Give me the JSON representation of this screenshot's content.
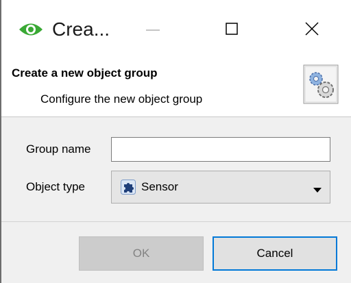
{
  "window": {
    "title": "Crea...",
    "app_icon": "eye-icon",
    "controls": {
      "minimize": "minimize-icon",
      "maximize": "maximize-icon",
      "close": "close-icon"
    }
  },
  "header": {
    "title": "Create a new object group",
    "subtitle": "Configure the new object group",
    "icon": "gears-icon"
  },
  "form": {
    "group_name": {
      "label": "Group name",
      "value": ""
    },
    "object_type": {
      "label": "Object type",
      "selected": "Sensor",
      "icon": "puzzle-piece-icon"
    }
  },
  "buttons": {
    "ok": "OK",
    "cancel": "Cancel"
  },
  "colors": {
    "accent": "#0078d7",
    "app_icon_green": "#3aa935",
    "body_bg": "#f0f0f0",
    "disabled_text": "#838383"
  }
}
